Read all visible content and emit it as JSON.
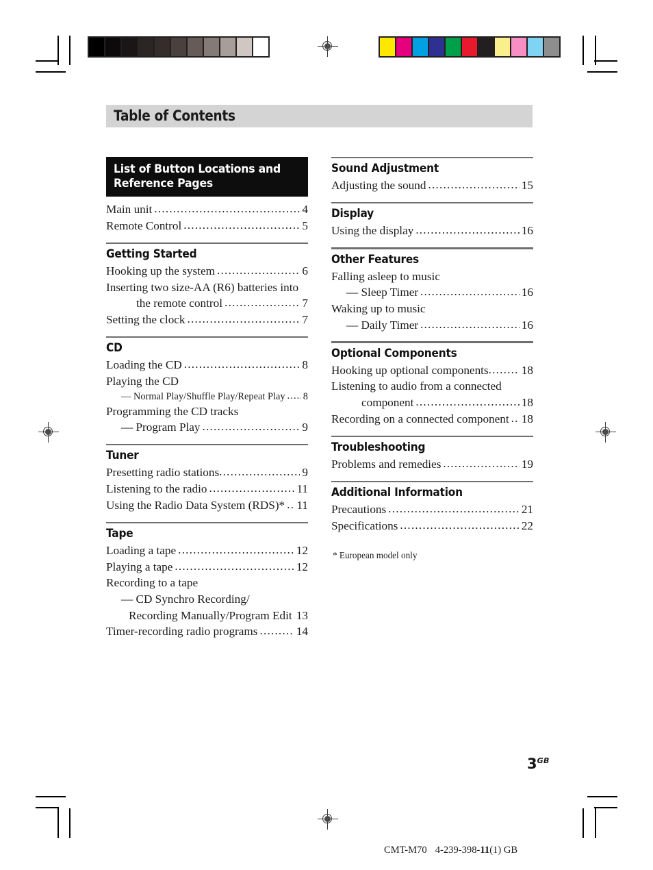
{
  "page": {
    "title": "Table of Contents",
    "folio_number": "3",
    "folio_suffix": "GB",
    "footnote": "* European model only"
  },
  "colophon": {
    "model": "CMT-M70",
    "part_prefix": "4-239-398-",
    "part_bold": "11",
    "part_suffix": "(1) GB"
  },
  "marks": {
    "grayscale_patches": [
      "#000000",
      "#0c0a0a",
      "#1a1615",
      "#2b2523",
      "#352d2b",
      "#4a403d",
      "#665b57",
      "#847a76",
      "#a79e9a",
      "#d0c6c2",
      "#ffffff"
    ],
    "color_patches": [
      "#ffe800",
      "#e6007e",
      "#00a0e3",
      "#2e3192",
      "#00a04a",
      "#e8192c",
      "#231f20",
      "#faef8c",
      "#f78fc4",
      "#7fd4f4",
      "#8e8e8e"
    ]
  },
  "left_column": [
    {
      "id": "list-of-button-locations",
      "rule": false,
      "heading_style": "inverse",
      "heading_lines": [
        "List of Button Locations and",
        "Reference Pages"
      ],
      "entries": [
        {
          "text": "Main unit",
          "page": "4",
          "indent": 0,
          "leader": true
        },
        {
          "text": "Remote Control",
          "page": "5",
          "indent": 0,
          "leader": true
        }
      ]
    },
    {
      "id": "getting-started",
      "rule": true,
      "heading_style": "plain",
      "heading": "Getting Started",
      "entries": [
        {
          "text": "Hooking up the system",
          "page": "6",
          "indent": 0,
          "leader": true
        },
        {
          "text": "Inserting two size-AA (R6) batteries into",
          "page": "",
          "indent": 0,
          "leader": false
        },
        {
          "text": "the remote control",
          "page": "7",
          "indent": 2,
          "leader": true
        },
        {
          "text": "Setting the clock",
          "page": "7",
          "indent": 0,
          "leader": true
        }
      ]
    },
    {
      "id": "cd",
      "rule": true,
      "heading_style": "plain",
      "heading": "CD",
      "entries": [
        {
          "text": "Loading the CD",
          "page": "8",
          "indent": 0,
          "leader": true
        },
        {
          "text": "Playing the CD",
          "page": "",
          "indent": 0,
          "leader": false
        },
        {
          "text": "— Normal Play/Shuffle Play/Repeat Play",
          "page": "8",
          "indent": 1,
          "leader": true,
          "small": true
        },
        {
          "text": "Programming the CD tracks",
          "page": "",
          "indent": 0,
          "leader": false
        },
        {
          "text": "— Program Play",
          "page": "9",
          "indent": 1,
          "leader": true
        }
      ]
    },
    {
      "id": "tuner",
      "rule": true,
      "heading_style": "plain",
      "heading": "Tuner",
      "entries": [
        {
          "text": "Presetting radio stations",
          "page": "9",
          "indent": 0,
          "leader": true,
          "tight": true
        },
        {
          "text": "Listening to the radio",
          "page": "11",
          "indent": 0,
          "leader": true
        },
        {
          "text": "Using the Radio Data System (RDS)*",
          "page": "11",
          "indent": 0,
          "leader": true
        }
      ]
    },
    {
      "id": "tape",
      "rule": true,
      "heading_style": "plain",
      "heading": "Tape",
      "entries": [
        {
          "text": "Loading a tape",
          "page": "12",
          "indent": 0,
          "leader": true
        },
        {
          "text": "Playing a tape",
          "page": "12",
          "indent": 0,
          "leader": true
        },
        {
          "text": "Recording to a tape",
          "page": "",
          "indent": 0,
          "leader": false
        },
        {
          "text": "— CD Synchro Recording/",
          "page": "",
          "indent": 1,
          "leader": false
        },
        {
          "text": "Recording Manually/Program Edit",
          "page": "13",
          "indent": 3,
          "leader": true
        },
        {
          "text": "Timer-recording radio programs",
          "page": "14",
          "indent": 0,
          "leader": true
        }
      ]
    }
  ],
  "right_column": [
    {
      "id": "sound-adjustment",
      "rule": true,
      "heading_style": "plain",
      "heading": "Sound Adjustment",
      "entries": [
        {
          "text": "Adjusting the sound",
          "page": "15",
          "indent": 0,
          "leader": true
        }
      ]
    },
    {
      "id": "display",
      "rule": true,
      "heading_style": "plain",
      "heading": "Display",
      "entries": [
        {
          "text": "Using the display",
          "page": "16",
          "indent": 0,
          "leader": true
        }
      ]
    },
    {
      "id": "other-features",
      "rule": true,
      "heading_style": "plain",
      "heading": "Other Features",
      "entries": [
        {
          "text": "Falling asleep to music",
          "page": "",
          "indent": 0,
          "leader": false
        },
        {
          "text": "— Sleep Timer",
          "page": "16",
          "indent": 1,
          "leader": true
        },
        {
          "text": "Waking up to music",
          "page": "",
          "indent": 0,
          "leader": false
        },
        {
          "text": "— Daily Timer",
          "page": "16",
          "indent": 1,
          "leader": true
        }
      ]
    },
    {
      "id": "optional-components",
      "rule": true,
      "heading_style": "plain",
      "heading": "Optional Components",
      "entries": [
        {
          "text": "Hooking up optional components",
          "page": "18",
          "indent": 0,
          "leader": true,
          "tight": true
        },
        {
          "text": "Listening to audio from a connected",
          "page": "",
          "indent": 0,
          "leader": false
        },
        {
          "text": "component",
          "page": "18",
          "indent": 2,
          "leader": true
        },
        {
          "text": "Recording on a connected component",
          "page": "18",
          "indent": 0,
          "leader": true
        }
      ]
    },
    {
      "id": "troubleshooting",
      "rule": true,
      "heading_style": "plain",
      "heading": "Troubleshooting",
      "entries": [
        {
          "text": "Problems and remedies",
          "page": "19",
          "indent": 0,
          "leader": true
        }
      ]
    },
    {
      "id": "additional-information",
      "rule": true,
      "heading_style": "plain",
      "heading": "Additional Information",
      "entries": [
        {
          "text": "Precautions",
          "page": "21",
          "indent": 0,
          "leader": true
        },
        {
          "text": "Specifications",
          "page": "22",
          "indent": 0,
          "leader": true
        }
      ]
    }
  ]
}
